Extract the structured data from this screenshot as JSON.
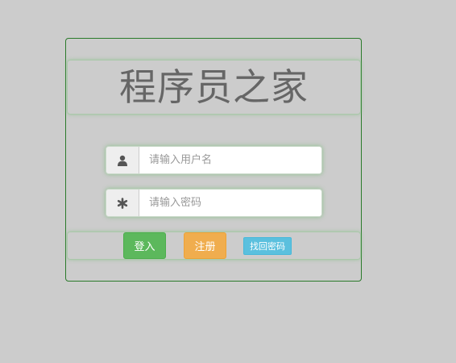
{
  "title": "程序员之家",
  "username": {
    "icon": "user-icon",
    "placeholder": "请输入用户名",
    "value": ""
  },
  "password": {
    "icon": "asterisk-icon",
    "placeholder": "请输入密码",
    "value": ""
  },
  "buttons": {
    "login": "登入",
    "register": "注册",
    "forgot": "找回密码"
  },
  "colors": {
    "background": "#cccccc",
    "title_text": "#666666",
    "panel_border": "#2a7a2a",
    "glow": "#78be78",
    "login": "#5cb85c",
    "register": "#f0ad4e",
    "forgot": "#5bc0de"
  }
}
